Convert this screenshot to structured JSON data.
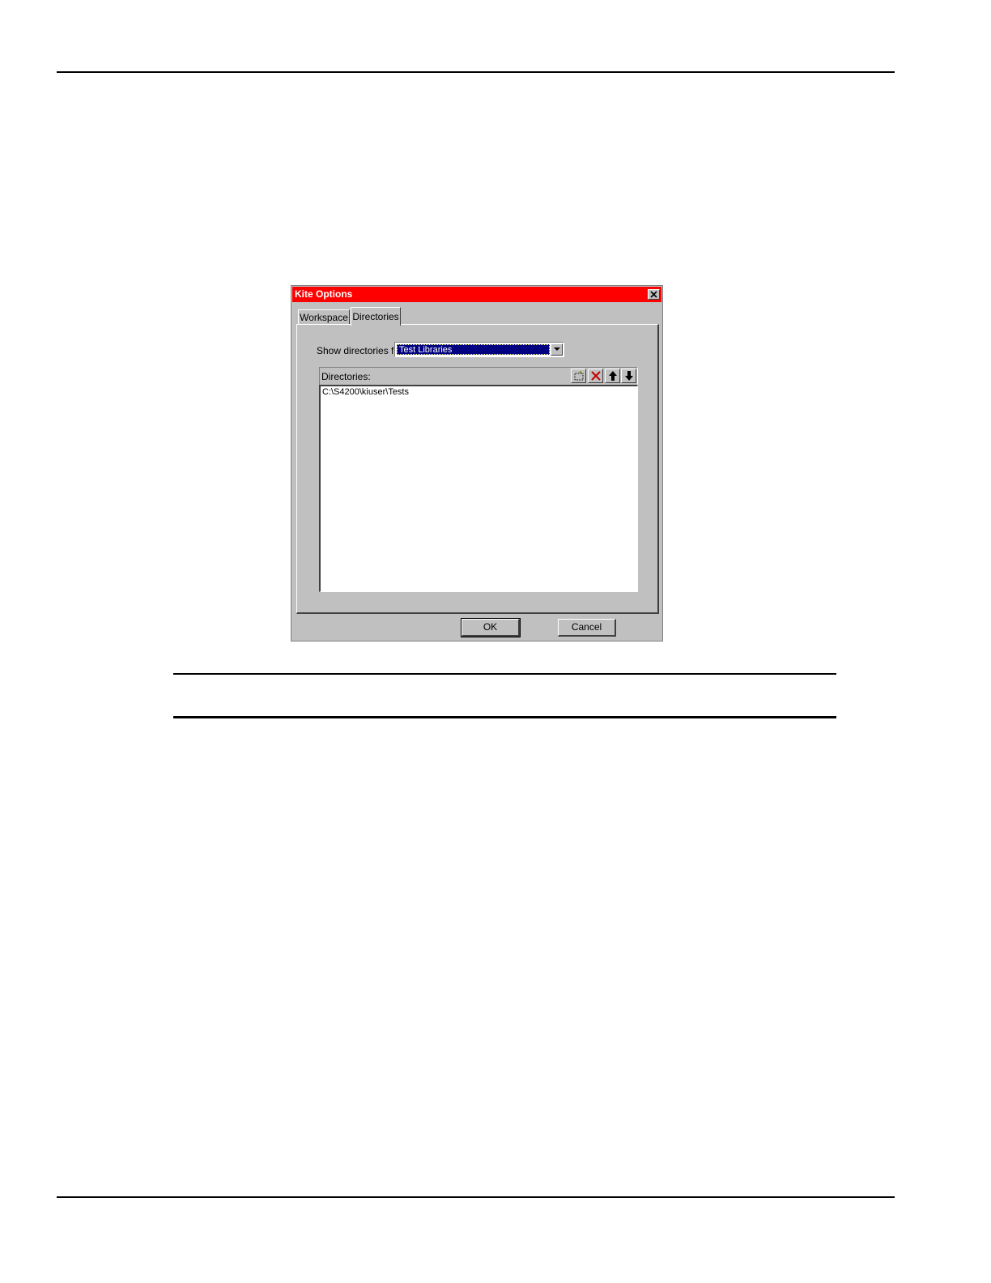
{
  "dialog": {
    "title": "Kite Options",
    "tabs": [
      {
        "label": "Workspace",
        "selected": false
      },
      {
        "label": "Directories",
        "selected": true
      }
    ],
    "show_label": "Show directories for:",
    "show_value": "Test Libraries",
    "directories_label": "Directories:",
    "directories": [
      "C:\\S4200\\kiuser\\Tests"
    ],
    "toolbar_icons": [
      "new-folder-icon",
      "delete-icon",
      "move-up-icon",
      "move-down-icon"
    ],
    "ok_label": "OK",
    "cancel_label": "Cancel",
    "colors": {
      "titlebar": "#ff0000",
      "face": "#c0c0c0",
      "selection": "#000080"
    }
  }
}
